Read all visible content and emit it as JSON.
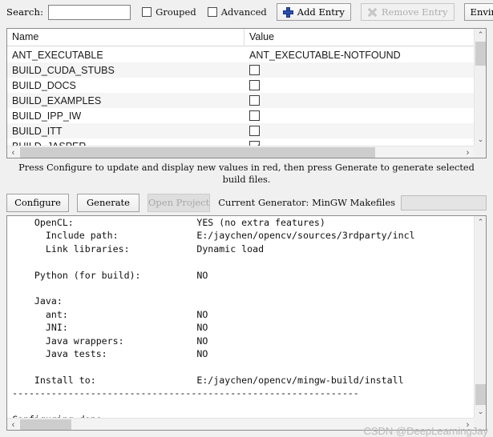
{
  "toolbar": {
    "search_label": "Search:",
    "search_value": "",
    "search_placeholder": "",
    "grouped_label": "Grouped",
    "grouped_checked": false,
    "advanced_label": "Advanced",
    "advanced_checked": false,
    "add_entry_label": "Add Entry",
    "remove_entry_label": "Remove Entry",
    "remove_entry_disabled": true,
    "environment_label": "Environment..."
  },
  "cache_table": {
    "columns": [
      "Name",
      "Value"
    ],
    "rows": [
      {
        "name": "ANT_EXECUTABLE",
        "type": "text",
        "value": "ANT_EXECUTABLE-NOTFOUND"
      },
      {
        "name": "BUILD_CUDA_STUBS",
        "type": "checkbox",
        "checked": false
      },
      {
        "name": "BUILD_DOCS",
        "type": "checkbox",
        "checked": false
      },
      {
        "name": "BUILD_EXAMPLES",
        "type": "checkbox",
        "checked": false
      },
      {
        "name": "BUILD_IPP_IW",
        "type": "checkbox",
        "checked": false
      },
      {
        "name": "BUILD_ITT",
        "type": "checkbox",
        "checked": false
      },
      {
        "name": "BUILD_JASPER",
        "type": "checkbox",
        "checked": true
      }
    ]
  },
  "hint": {
    "line1": "Press Configure to update and display new values in red, then press Generate to generate selected",
    "line2": "build files."
  },
  "actions": {
    "configure_label": "Configure",
    "generate_label": "Generate",
    "open_project_label": "Open Project",
    "open_project_disabled": true,
    "generator_label": "Current Generator: MinGW Makefiles",
    "progress_percent": 0
  },
  "log": {
    "text": "    OpenCL:                      YES (no extra features)\n      Include path:              E:/jaychen/opencv/sources/3rdparty/incl\n      Link libraries:            Dynamic load\n\n    Python (for build):          NO\n\n    Java:\n      ant:                       NO\n      JNI:                       NO\n      Java wrappers:             NO\n      Java tests:                NO\n\n    Install to:                  E:/jaychen/opencv/mingw-build/install\n--------------------------------------------------------------\n\nConfiguring done"
  },
  "watermark": {
    "text": "CSDN @DeepLearningJay"
  },
  "icons": {
    "scroll_up": "⌃",
    "scroll_down": "⌄",
    "scroll_left": "‹",
    "scroll_right": "›"
  }
}
